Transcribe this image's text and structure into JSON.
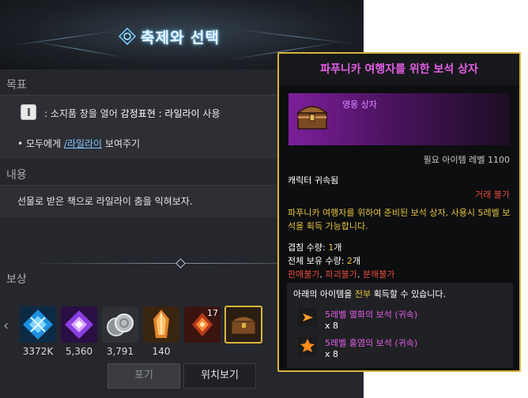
{
  "quest": {
    "title": "축제와 선택",
    "objective_label": "목표",
    "objective": {
      "prefix": ": 소지품 창을 열어 ",
      "highlight": "감정표현 : 라일라이",
      "suffix": " 사용"
    },
    "task": {
      "bullet": "•",
      "prefix": "모두에게 ",
      "link": "/라일라이",
      "suffix": " 보여주기"
    },
    "content_label": "내용",
    "content_text": "선물로 받은 책으로 라일라이 춤을 익혀보자.",
    "reward_label": "보상",
    "rewards": [
      {
        "icon": "blue-crystal-icon",
        "count": "3372K"
      },
      {
        "icon": "purple-crystal-icon",
        "count": "5,360"
      },
      {
        "icon": "silver-coins-icon",
        "count": "3,791"
      },
      {
        "icon": "orange-crystal-shard-icon",
        "count": "140"
      },
      {
        "icon": "fire-gem-icon",
        "count": "",
        "stack": "17"
      },
      {
        "icon": "treasure-chest-icon",
        "count": ""
      }
    ],
    "buttons": {
      "abandon": "포기",
      "locate": "위치보기"
    }
  },
  "tooltip": {
    "title": "파푸니카 여행자를 위한 보석 상자",
    "grade": "영웅 상자",
    "required_level": "필요 아이템 레벨 1100",
    "bound": "캐릭터 귀속됨",
    "trade": "거래 불가",
    "description": "파푸니카 여행자를 위하여 준비된 보석 상자, 사용시 5레벨 보석을 획득 가능합니다.",
    "stack_label": "겹침 수량: ",
    "stack_value": "1",
    "stack_unit": "개",
    "owned_label": "전체 보유 수량: ",
    "owned_value": "2",
    "owned_unit": "개",
    "restrictions": [
      "판매불가",
      "파괴불가",
      "분해불가"
    ],
    "choice_prefix": "아래의 아이템을 ",
    "choice_highlight": "전부",
    "choice_suffix": " 획득할 수 있습니다.",
    "items": [
      {
        "name": "5레벨 멸화의 보석 (귀속)",
        "qty": "x 8",
        "icon": "ruin-gem-icon"
      },
      {
        "name": "5레벨 홍염의 보석 (귀속)",
        "qty": "x 8",
        "icon": "crimson-gem-icon"
      }
    ]
  },
  "colors": {
    "accent_gold": "#d9b53a",
    "title_purple": "#e35ee8",
    "warning_red": "#e24a3d",
    "highlight_yellow": "#e6c43e",
    "link_blue": "#7ec3ff"
  }
}
